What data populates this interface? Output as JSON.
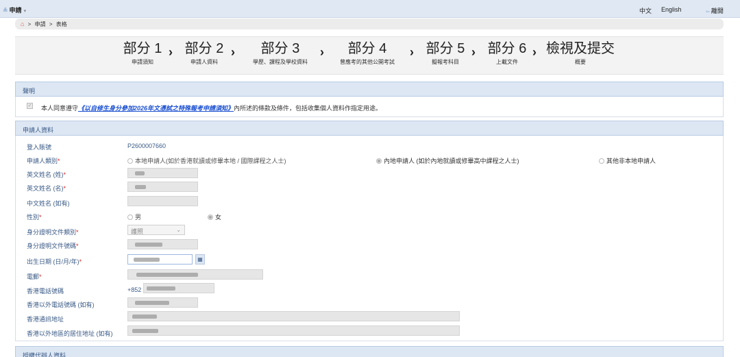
{
  "topbar": {
    "menu_label": "申請",
    "lang_zh": "中文",
    "lang_en": "English",
    "logout": "離開"
  },
  "breadcrumb": {
    "items": [
      "申請",
      "表格"
    ],
    "separator": ">"
  },
  "steps": [
    {
      "title": "部分 1",
      "sub": "申請須知"
    },
    {
      "title": "部分 2",
      "sub": "申請人資料"
    },
    {
      "title": "部分 3",
      "sub": "學歷、課程及學校資料"
    },
    {
      "title": "部分 4",
      "sub": "曾應考的其他公開考試"
    },
    {
      "title": "部分 5",
      "sub": "擬報考科目"
    },
    {
      "title": "部分 6",
      "sub": "上載文件"
    },
    {
      "title": "檢視及提交",
      "sub": "概要"
    }
  ],
  "step_separator": "›",
  "declaration": {
    "heading": "聲明",
    "text_before": "本人同意遵守",
    "link_text": "《以自修生身分參加2026年文憑試之特殊報考申請須知》",
    "text_after": "內所述的條款及條件，包括收集個人資料作指定用途。",
    "checked": true
  },
  "applicant": {
    "heading": "申請人資料",
    "login_label": "登入賬號",
    "login_value": "P2600007660",
    "category_label": "申請人類別",
    "category_options": [
      "本地申請人(如於香港就讀或修畢本地 / 國際課程之人士)",
      "內地申請人 (如於內地就讀或修畢高中課程之人士)",
      "其他非本地申請人"
    ],
    "category_selected": 1,
    "surname_label": "英文姓名 (姓)",
    "given_name_label": "英文姓名 (名)",
    "chinese_name_label": "中文姓名 (如有)",
    "gender_label": "性別",
    "gender_options": [
      "男",
      "女"
    ],
    "gender_selected": 1,
    "id_type_label": "身分證明文件類別",
    "id_type_value": "護照",
    "id_number_label": "身分證明文件號碼",
    "dob_label": "出生日期 (日/月/年)",
    "email_label": "電郵",
    "hk_phone_label": "香港電話號碼",
    "hk_phone_prefix": "+852",
    "other_phone_label": "香港以外電話號碼 (如有)",
    "hk_address_label": "香港通訊地址",
    "other_address_label": "香港以外地區的居住地址 (如有)"
  },
  "agent": {
    "heading": "授權代辦人資料"
  },
  "required_mark": "*",
  "icons": {
    "user": "user-icon",
    "home": "home-icon",
    "calendar": "calendar-icon",
    "logout": "logout-icon"
  }
}
